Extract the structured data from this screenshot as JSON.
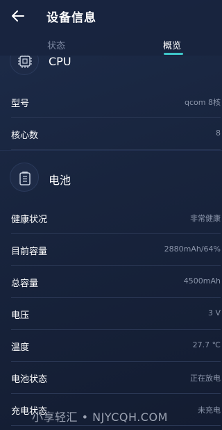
{
  "header": {
    "title": "设备信息",
    "tabs": [
      {
        "label": "状态",
        "active": false
      },
      {
        "label": "概览",
        "active": true
      }
    ],
    "accent_color": "#3ec6c9"
  },
  "cpu": {
    "title": "CPU",
    "icon": "cpu-chip-icon",
    "rows": [
      {
        "label": "型号",
        "value": "qcom 8核"
      },
      {
        "label": "核心数",
        "value": "8"
      }
    ]
  },
  "battery": {
    "title": "电池",
    "icon": "battery-icon",
    "rows": [
      {
        "label": "健康状况",
        "value": "非常健康"
      },
      {
        "label": "目前容量",
        "value": "2880mAh/64%"
      },
      {
        "label": "总容量",
        "value": "4500mAh"
      },
      {
        "label": "电压",
        "value": "3 V"
      },
      {
        "label": "温度",
        "value": "27.7 ℃"
      },
      {
        "label": "电池状态",
        "value": "正在放电"
      },
      {
        "label": "充电状态",
        "value": "未充电"
      }
    ]
  },
  "watermark": "小享轻汇 • NJYCQH.COM"
}
